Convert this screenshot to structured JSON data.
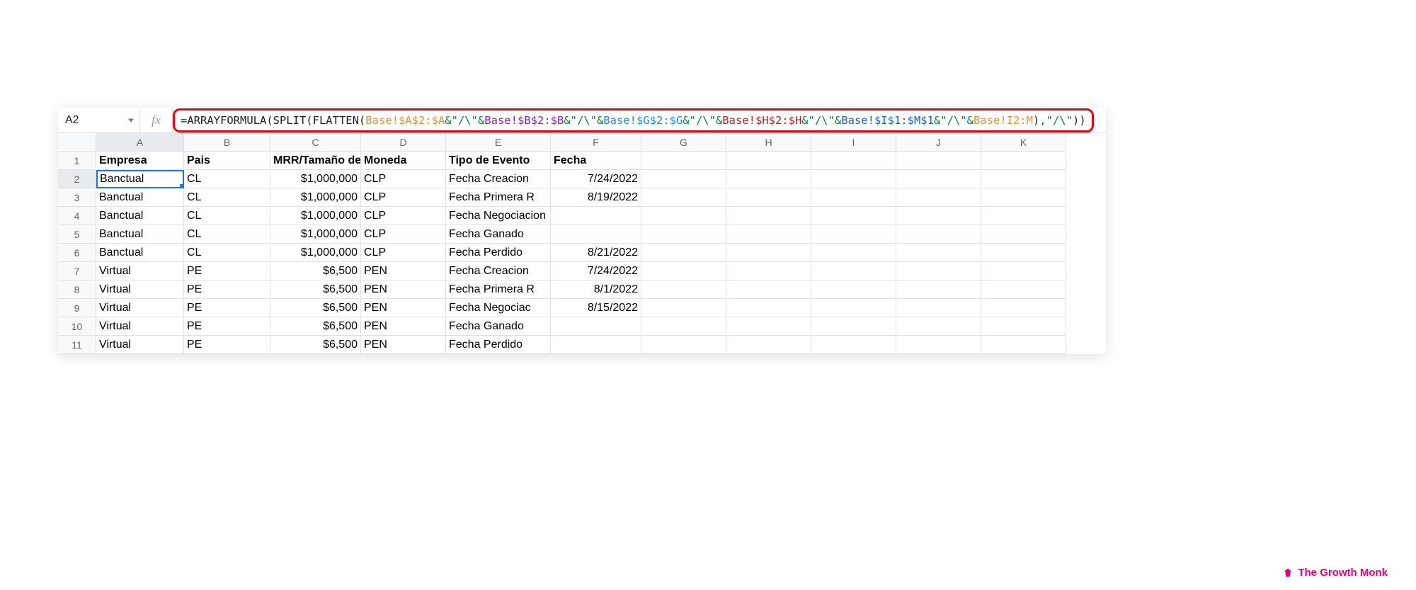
{
  "name_box": "A2",
  "fx_label": "fx",
  "formula": {
    "pre": "=ARRAYFORMULA(SPLIT(FLATTEN(",
    "ref1": "Base!$A$2:$A",
    "amp": "&",
    "str": "\"/\\\"",
    "ref2": "Base!$B$2:$B",
    "ref3": "Base!$G$2:$G",
    "ref4": "Base!$H$2:$H",
    "ref5": "Base!$I$1:$M$1",
    "ref6": "Base!I2:M",
    "close_inner": ")",
    "sep": ",",
    "str2": "\"/\\\"",
    "close_outer": "))"
  },
  "columns": [
    "A",
    "B",
    "C",
    "D",
    "E",
    "F",
    "G",
    "H",
    "I",
    "J",
    "K"
  ],
  "row_numbers": [
    "1",
    "2",
    "3",
    "4",
    "5",
    "6",
    "7",
    "8",
    "9",
    "10",
    "11"
  ],
  "headers": [
    "Empresa",
    "Pais",
    "MRR/Tamaño de",
    "Moneda",
    "Tipo de Evento",
    "Fecha"
  ],
  "rows": [
    {
      "empresa": "Banctual",
      "pais": "CL",
      "mrr": "$1,000,000",
      "moneda": "CLP",
      "tipo": "Fecha Creacion",
      "fecha": "7/24/2022"
    },
    {
      "empresa": "Banctual",
      "pais": "CL",
      "mrr": "$1,000,000",
      "moneda": "CLP",
      "tipo": "Fecha Primera R",
      "fecha": "8/19/2022"
    },
    {
      "empresa": "Banctual",
      "pais": "CL",
      "mrr": "$1,000,000",
      "moneda": "CLP",
      "tipo": "Fecha Negociacion",
      "fecha": ""
    },
    {
      "empresa": "Banctual",
      "pais": "CL",
      "mrr": "$1,000,000",
      "moneda": "CLP",
      "tipo": "Fecha Ganado",
      "fecha": ""
    },
    {
      "empresa": "Banctual",
      "pais": "CL",
      "mrr": "$1,000,000",
      "moneda": "CLP",
      "tipo": "Fecha Perdido",
      "fecha": "8/21/2022"
    },
    {
      "empresa": "Virtual",
      "pais": "PE",
      "mrr": "$6,500",
      "moneda": "PEN",
      "tipo": "Fecha Creacion",
      "fecha": "7/24/2022"
    },
    {
      "empresa": "Virtual",
      "pais": "PE",
      "mrr": "$6,500",
      "moneda": "PEN",
      "tipo": "Fecha Primera R",
      "fecha": "8/1/2022"
    },
    {
      "empresa": "Virtual",
      "pais": "PE",
      "mrr": "$6,500",
      "moneda": "PEN",
      "tipo": "Fecha Negociac",
      "fecha": "8/15/2022"
    },
    {
      "empresa": "Virtual",
      "pais": "PE",
      "mrr": "$6,500",
      "moneda": "PEN",
      "tipo": "Fecha Ganado",
      "fecha": ""
    },
    {
      "empresa": "Virtual",
      "pais": "PE",
      "mrr": "$6,500",
      "moneda": "PEN",
      "tipo": "Fecha Perdido",
      "fecha": ""
    }
  ],
  "watermark": "The Growth Monk"
}
